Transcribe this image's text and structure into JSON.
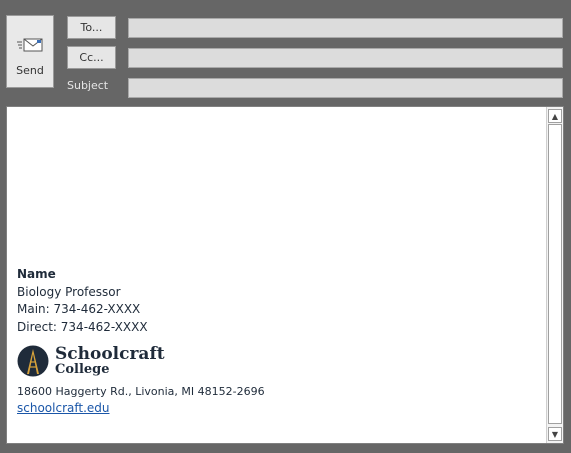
{
  "compose": {
    "send_label": "Send",
    "to_label": "To...",
    "cc_label": "Cc...",
    "subject_label": "Subject",
    "to_value": "",
    "cc_value": "",
    "subject_value": ""
  },
  "signature": {
    "name": "Name",
    "title": "Biology Professor",
    "main_phone": "Main: 734-462-XXXX",
    "direct_phone": "Direct: 734-462-XXXX",
    "logo_line1": "Schoolcraft",
    "logo_line2": "College",
    "address": "18600 Haggerty Rd., Livonia, MI 48152-2696",
    "website": "schoolcraft.edu"
  },
  "colors": {
    "window_bg": "#666666",
    "brand_navy": "#1f2b3a",
    "brand_gold": "#d7a23a",
    "link": "#1a56a8"
  }
}
